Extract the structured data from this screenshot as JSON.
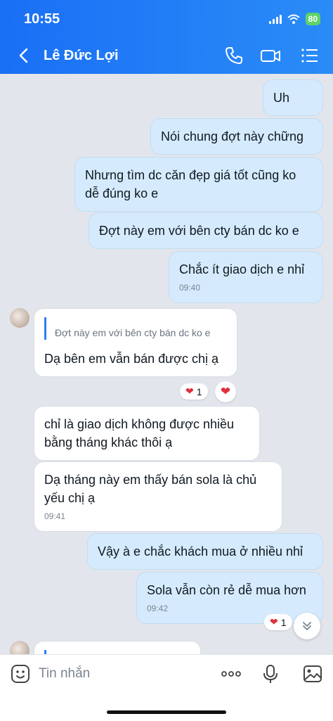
{
  "status_bar": {
    "time": "10:55",
    "battery": "80"
  },
  "header": {
    "contact_name": "Lê Đức Lợi"
  },
  "messages": [
    {
      "text": "Uh"
    },
    {
      "text": "Nói chung đợt này chững"
    },
    {
      "text": "Nhưng tìm dc căn đẹp giá tốt cũng ko dễ đúng ko e"
    },
    {
      "text": "Đợt này em với bên cty bán dc ko e"
    },
    {
      "text": "Chắc ít giao dịch e nhỉ",
      "time": "09:40"
    },
    {
      "quote": "Đợt này em với bên cty bán dc ko e",
      "text": "Dạ bên em vẫn bán được chị ạ",
      "reaction_count": "1"
    },
    {
      "text": "chỉ là giao dịch không được nhiều bằng tháng khác thôi ạ"
    },
    {
      "text": "Dạ tháng này em thấy bán sola là chủ yếu chị ạ",
      "time": "09:41"
    },
    {
      "text": "Vậy à e chắc khách mua ở nhiều nhỉ"
    },
    {
      "text": "Sola vẫn còn rẻ dễ mua hơn",
      "time": "09:42",
      "reaction_count": "1"
    }
  ],
  "input": {
    "placeholder": "Tin nhắn"
  },
  "colors": {
    "header": "#1a6ff5",
    "outgoing_bubble": "#d5ebfd",
    "incoming_bubble": "#ffffff",
    "heart": "#e02f3d"
  }
}
